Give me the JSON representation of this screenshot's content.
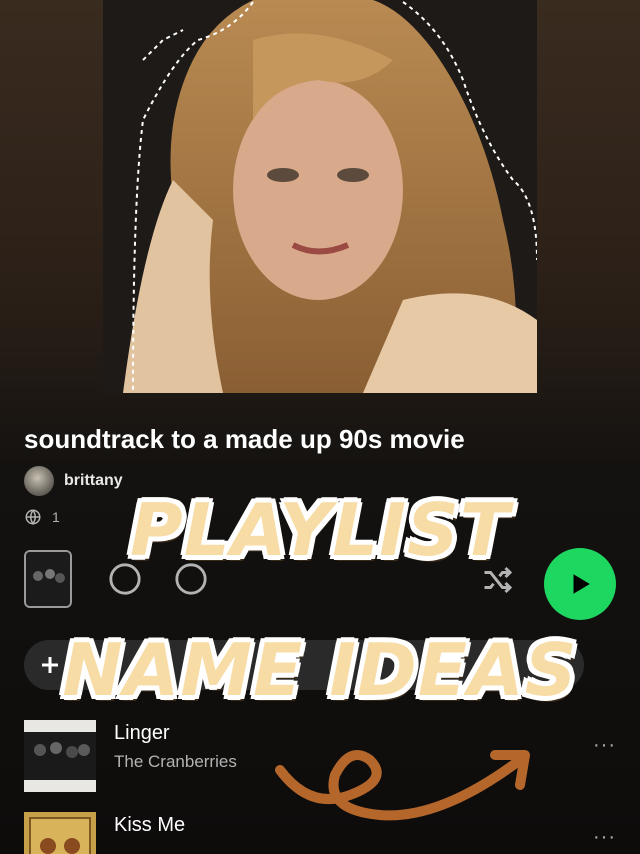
{
  "playlist": {
    "title": "soundtrack to a made up 90s movie",
    "owner": "brittany",
    "meta_prefix": "1"
  },
  "overlay": {
    "line1": "PLAYLIST",
    "line2": "NAME IDEAS"
  },
  "tracks": [
    {
      "name": "Linger",
      "artist": "The Cranberries",
      "more": "···"
    },
    {
      "name": "Kiss Me",
      "artist": "",
      "more": "···"
    }
  ],
  "colors": {
    "accent_green": "#1ed760",
    "overlay_text": "#f7dca6",
    "swoosh": "#b5672b"
  },
  "icons": [
    "globe-icon",
    "add-icon",
    "download-icon",
    "shuffle-icon",
    "play-icon",
    "more-icon"
  ]
}
